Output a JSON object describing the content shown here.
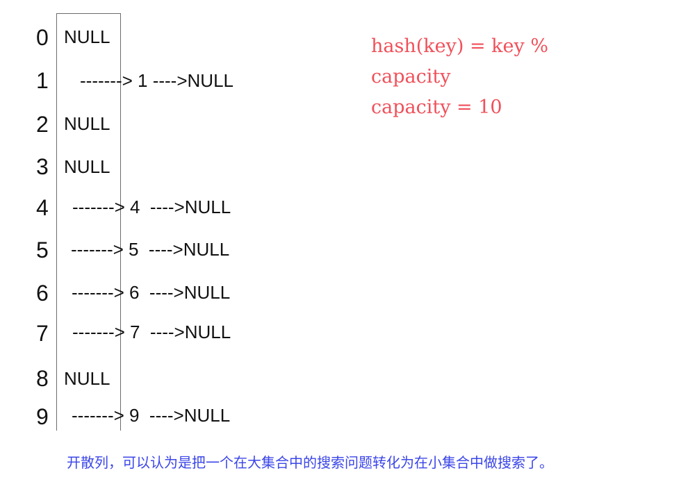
{
  "hash_table": {
    "buckets": [
      {
        "index": "0",
        "content": "NULL"
      },
      {
        "index": "1",
        "content": "-------> 1 ---->NULL"
      },
      {
        "index": "2",
        "content": "NULL"
      },
      {
        "index": "3",
        "content": "NULL"
      },
      {
        "index": "4",
        "content": "-------> 4  ---->NULL"
      },
      {
        "index": "5",
        "content": "-------> 5  ---->NULL"
      },
      {
        "index": "6",
        "content": "-------> 6  ---->NULL"
      },
      {
        "index": "7",
        "content": "-------> 7  ---->NULL"
      },
      {
        "index": "8",
        "content": "NULL"
      },
      {
        "index": "9",
        "content": "-------> 9  ---->NULL"
      }
    ]
  },
  "formula": {
    "line1": "hash(key) = key %",
    "line2": "capacity",
    "line3": "capacity = 10"
  },
  "caption": "开散列，可以认为是把一个在大集合中的搜索问题转化为在小集合中做搜索了。",
  "colors": {
    "formula": "#f0505a",
    "caption": "#3b46e8",
    "text": "#111111"
  }
}
